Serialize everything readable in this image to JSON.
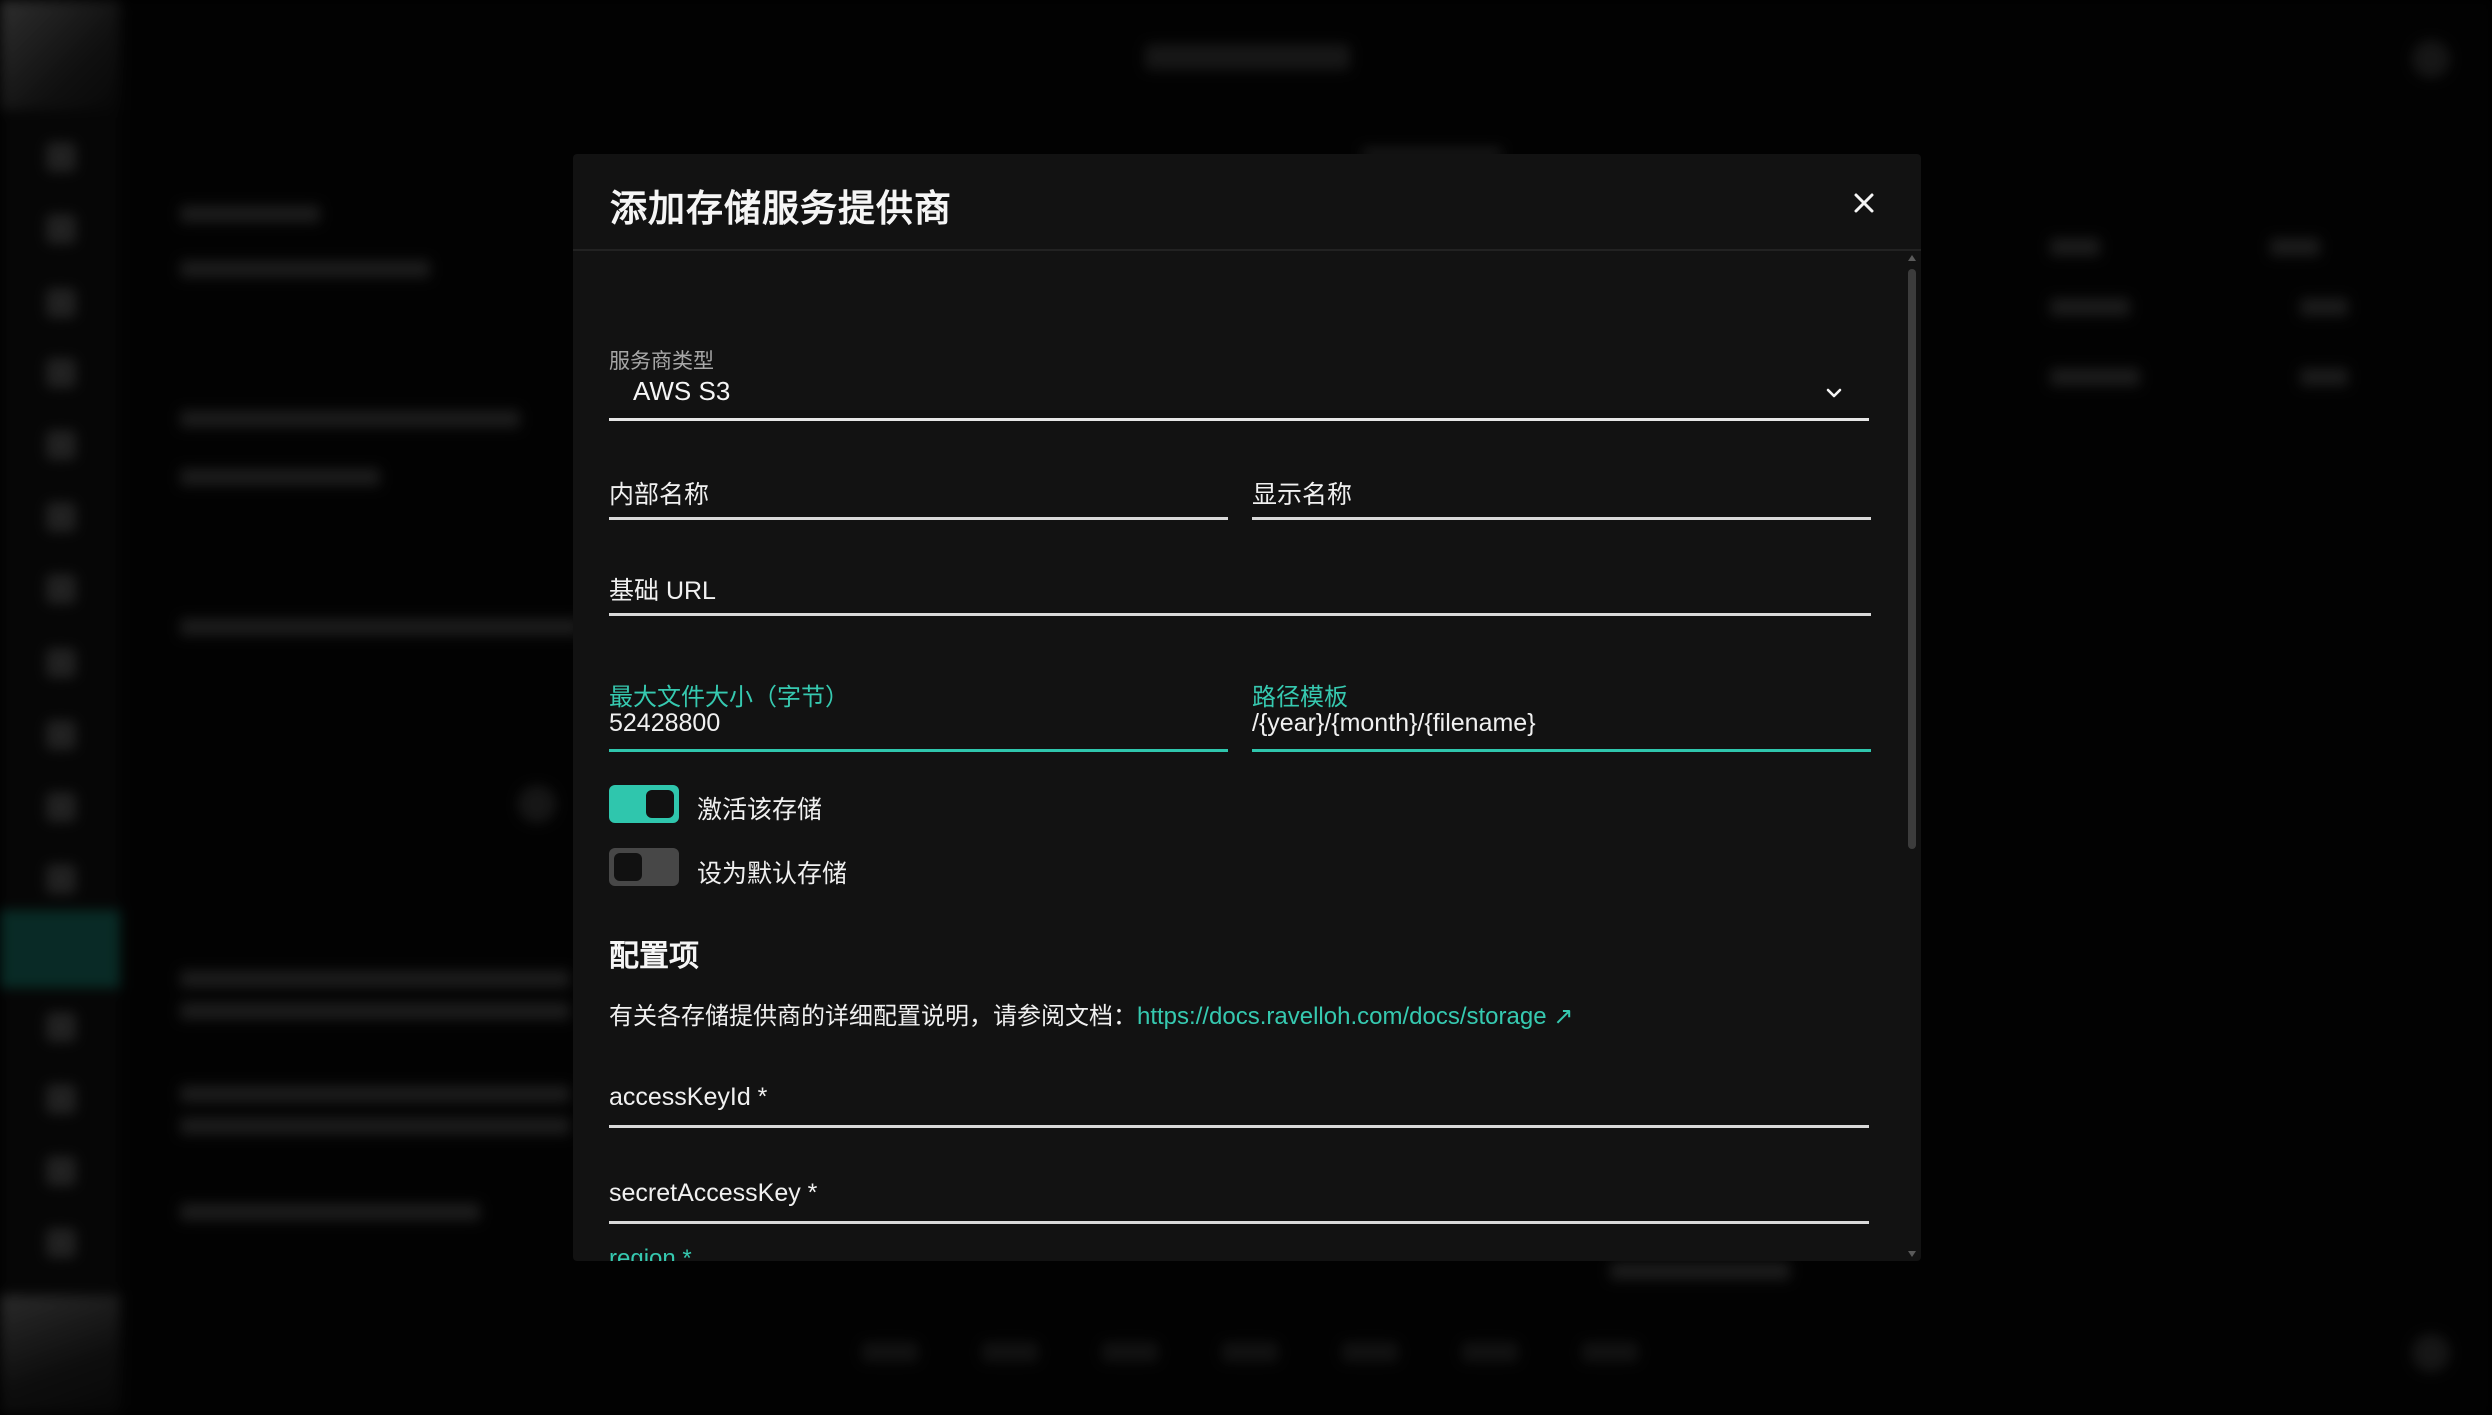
{
  "modal": {
    "title": "添加存储服务提供商",
    "close_icon": "close-icon"
  },
  "form": {
    "provider_type_label": "服务商类型",
    "provider_type_value": "AWS S3",
    "internal_name_placeholder": "内部名称",
    "display_name_placeholder": "显示名称",
    "base_url_placeholder": "基础 URL",
    "max_file_size_label": "最大文件大小（字节）",
    "max_file_size_value": "52428800",
    "path_template_label": "路径模板",
    "path_template_value": "/{year}/{month}/{filename}",
    "activate_label": "激活该存储",
    "activate_on": true,
    "default_label": "设为默认存储",
    "default_on": false
  },
  "config": {
    "section_title": "配置项",
    "doc_text": "有关各存储提供商的详细配置说明，请参阅文档：",
    "doc_link": "https://docs.ravelloh.com/docs/storage",
    "doc_link_arrow": "↗",
    "access_key_placeholder": "accessKeyId *",
    "secret_key_placeholder": "secretAccessKey *",
    "region_label": "region *"
  },
  "colors": {
    "accent": "#2fc6ad",
    "modal_bg": "#121212",
    "page_bg": "#000000"
  }
}
